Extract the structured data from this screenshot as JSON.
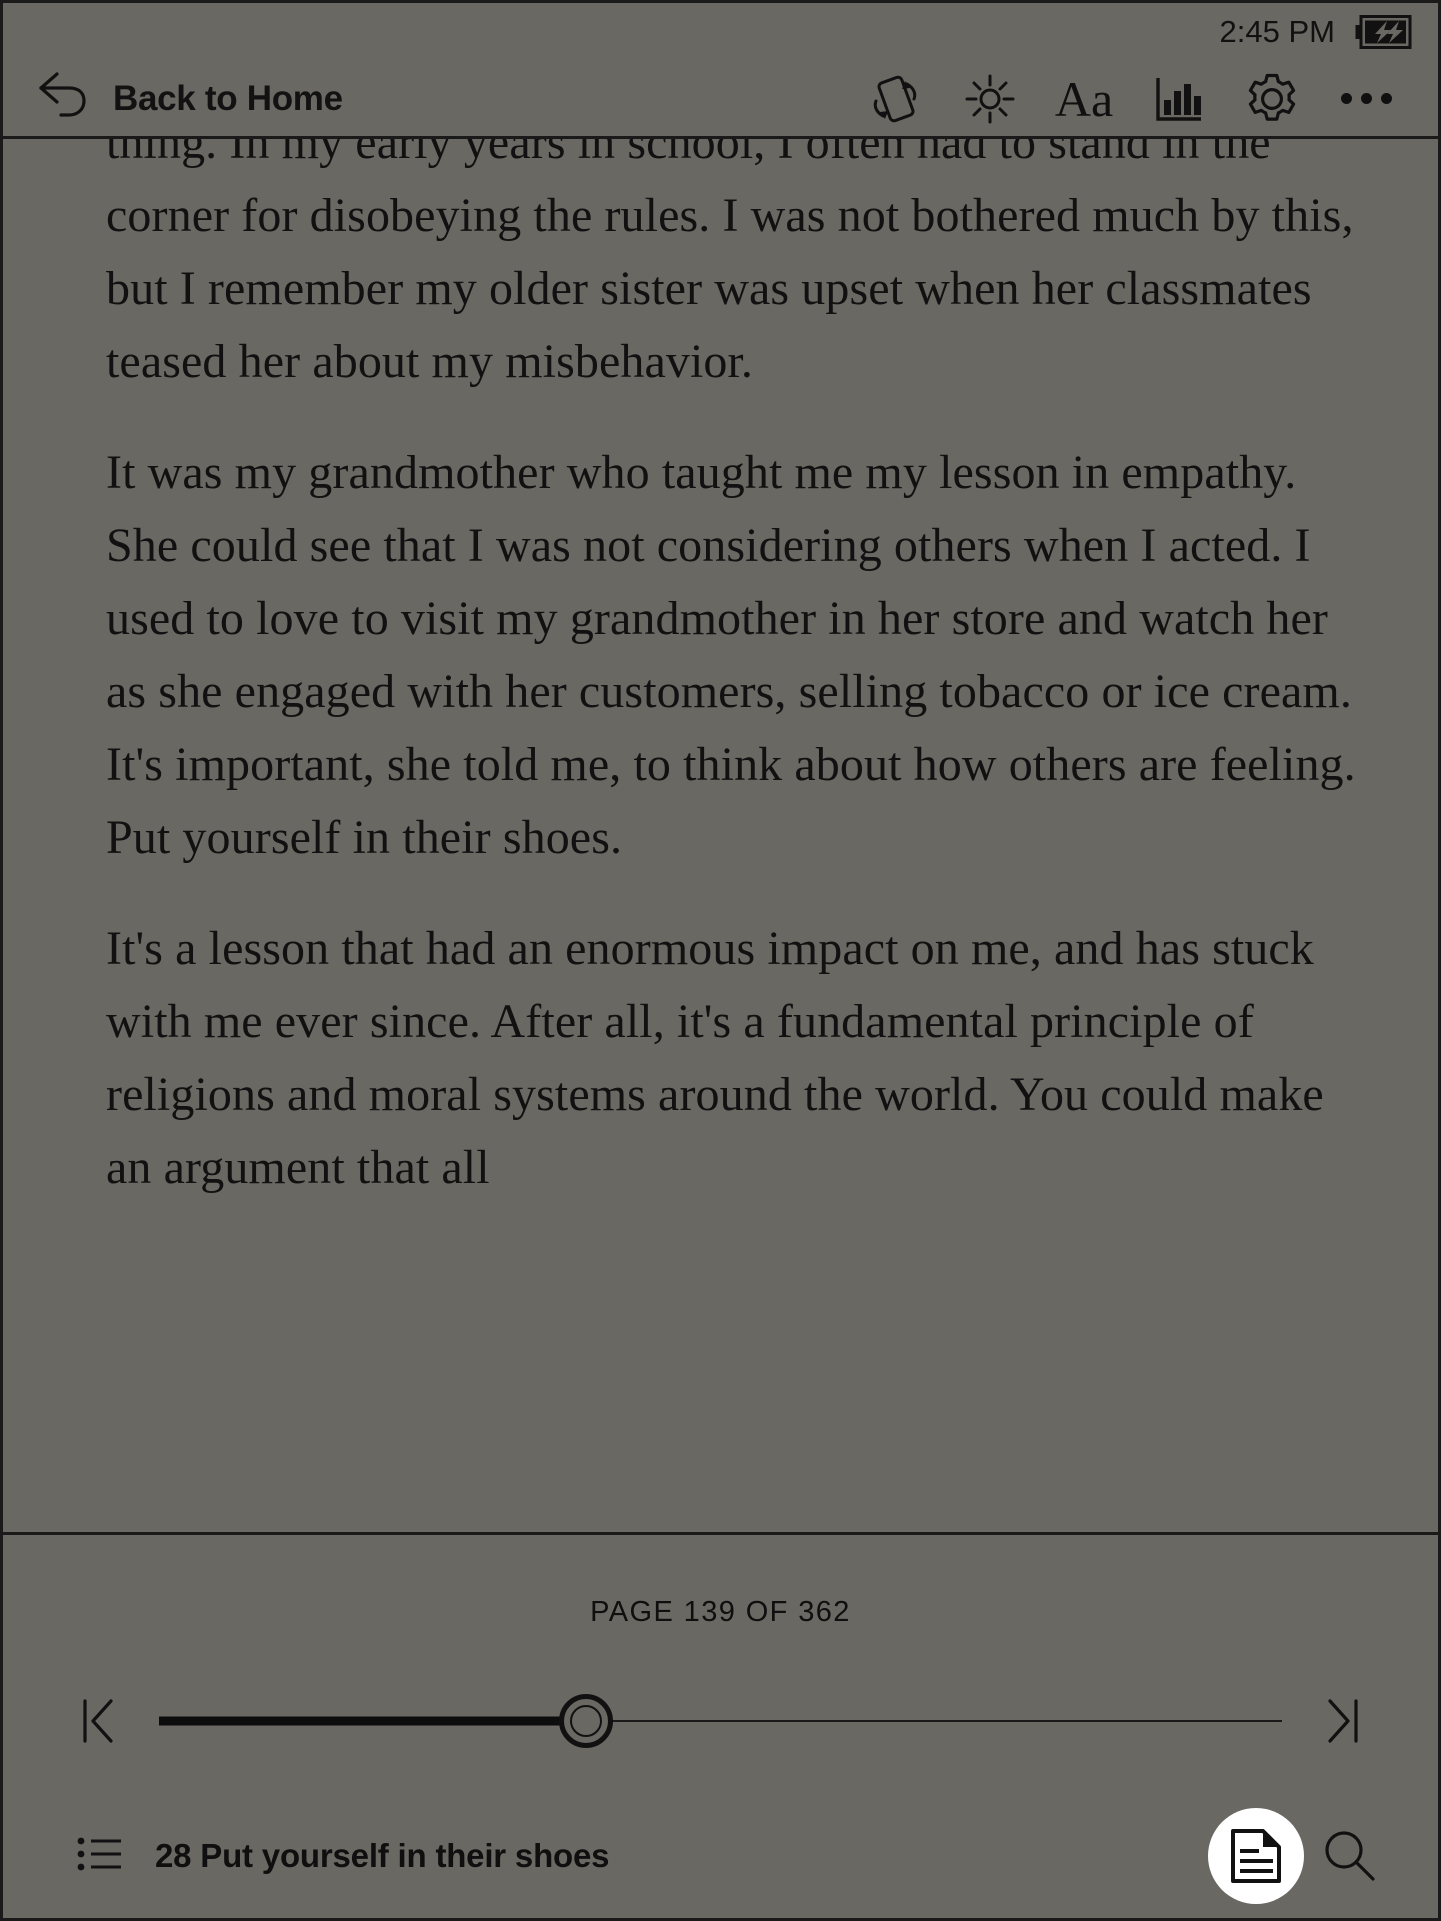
{
  "device": {
    "background_color": "#6a6863",
    "ink_color": "#111111",
    "accent_color": "#ffffff"
  },
  "status_bar": {
    "time": "2:45 PM",
    "battery_icon": "battery-charging-icon",
    "battery_state": "charging"
  },
  "header": {
    "back_icon": "back-arrow-icon",
    "back_label": "Back to Home",
    "icons": [
      {
        "name": "rotate-orientation-icon",
        "label": "Rotate"
      },
      {
        "name": "brightness-icon",
        "label": "Brightness"
      },
      {
        "name": "font-size-icon",
        "label": "Aa"
      },
      {
        "name": "reading-stats-icon",
        "label": "Reading stats"
      },
      {
        "name": "settings-gear-icon",
        "label": "Settings"
      },
      {
        "name": "more-options-icon",
        "label": "More"
      }
    ],
    "font_icon_label": "Aa"
  },
  "reader": {
    "paragraphs": [
      "thing. In my early years in school, I often had to stand in the corner for disobeying the rules. I was not bothered much by this, but I remember my older sister was upset when her classmates teased her about my misbehavior.",
      "It was my grandmother who taught me my lesson in empathy. She could see that I was not considering others when I acted. I used to love to visit my grandmother in her store and watch her as she engaged with her customers, selling tobacco or ice cream. It's important, she told me, to think about how others are feeling. Put yourself in their shoes.",
      "It's a lesson that had an enormous impact on me, and has stuck with me ever since. After all, it's a fundamental principle of religions and moral systems around the world. You could make an argument that all"
    ]
  },
  "bottom_panel": {
    "page_indicator": "PAGE 139 OF 362",
    "current_page": 139,
    "total_pages": 362,
    "progress_percent": 38,
    "skip_start_icon": "skip-to-start-icon",
    "skip_end_icon": "skip-to-end-icon",
    "slider_handle_icon": "slider-handle",
    "toc_icon": "table-of-contents-icon",
    "chapter_title": "28 Put yourself in their shoes",
    "notes_icon": "document-notes-icon",
    "search_icon": "search-icon"
  }
}
